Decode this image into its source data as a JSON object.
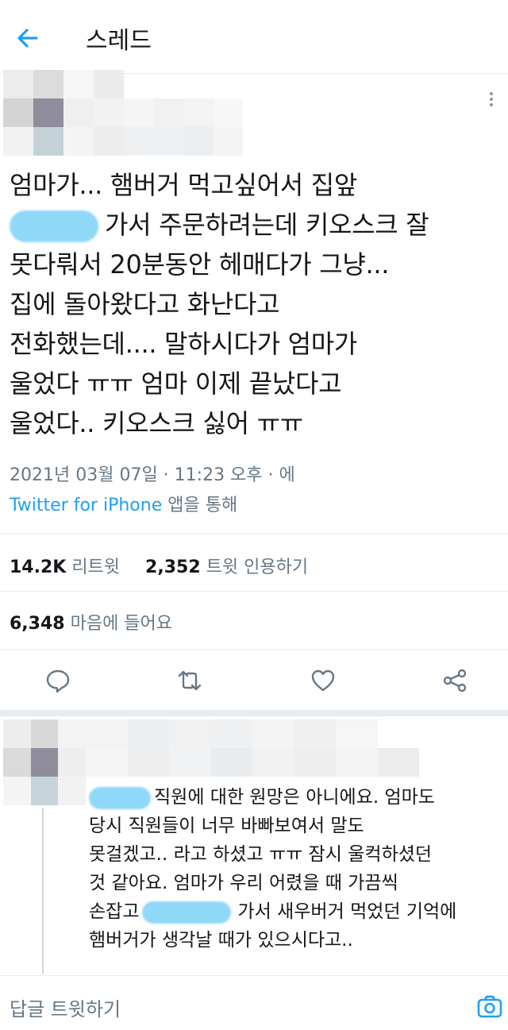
{
  "header": {
    "title": "스레드"
  },
  "tweet": {
    "lines": [
      "엄마가... 햄버거 먹고싶어서 집앞",
      "가서 주문하려는데 키오스크 잘",
      "못다뤄서 20분동안 헤매다가 그냥...",
      "집에 돌아왔다고 화난다고",
      "전화했는데.... 말하시다가 엄마가",
      "울었다 ㅠㅠ 엄마 이제 끝났다고",
      "울었다.. 키오스크 싫어 ㅠㅠ"
    ],
    "meta": "2021년 03월 07일 · 11:23 오후 · 에",
    "source_link": "Twitter for iPhone",
    "source_suffix": " 앱을 통해"
  },
  "stats": {
    "retweets": {
      "count": "14.2K",
      "label": " 리트윗"
    },
    "quotes": {
      "count": "2,352",
      "label": " 트윗 인용하기"
    },
    "likes": {
      "count": "6,348",
      "label": " 마음에 들어요"
    }
  },
  "icons": {
    "back": "arrow-left-icon",
    "more": "more-vertical-icon",
    "reply": "comment-icon",
    "retweet": "retweet-icon",
    "like": "heart-icon",
    "share": "share-icon",
    "camera": "camera-icon"
  },
  "colors": {
    "accent": "#1da1f2",
    "muted": "#657786",
    "redaction": "#8fd8f8"
  },
  "reply": {
    "lines": [
      "직원에 대한 원망은 아니에요. 엄마도",
      "당시 직원들이 너무 바빠보여서 말도",
      "못걸겠고.. 라고 하셨고 ㅠㅠ 잠시 울컥하셨던",
      "것 같아요. 엄마가 우리 어렸을 때 가끔씩",
      "손잡고",
      "가서 새우버거 먹었던 기억에",
      "햄버거가 생각날 때가 있으시다고.."
    ]
  },
  "compose": {
    "placeholder": "답글 트윗하기"
  }
}
